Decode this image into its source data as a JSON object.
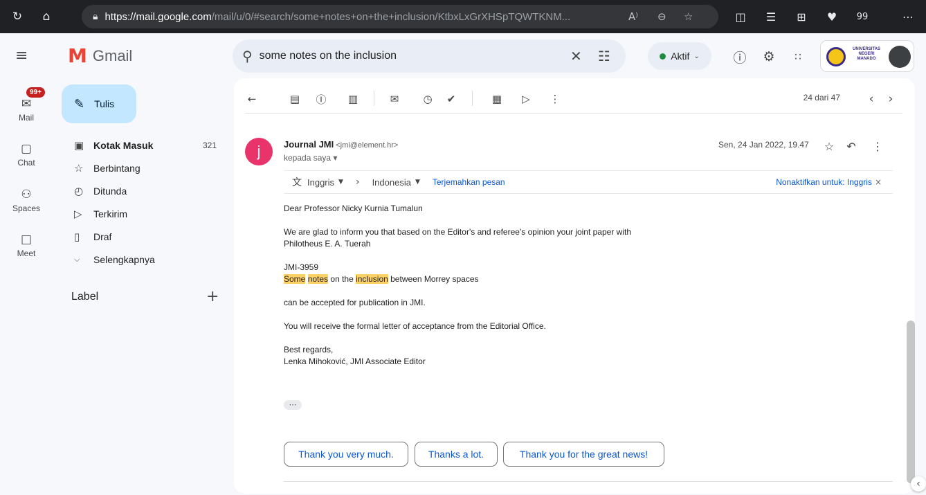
{
  "browser": {
    "url_host": "https://mail.google.com",
    "url_path": "/mail/u/0/#search/some+notes+on+the+inclusion/KtbxLxGrXHSpTQWTKNM...",
    "read_aloud": "A⁾",
    "toolbar_badge": "99"
  },
  "app": {
    "name": "Gmail",
    "status_label": "Aktif"
  },
  "rail": {
    "mail_label": "Mail",
    "mail_badge": "99+",
    "chat_label": "Chat",
    "spaces_label": "Spaces",
    "meet_label": "Meet"
  },
  "sidebar": {
    "compose_label": "Tulis",
    "items": [
      {
        "label": "Kotak Masuk",
        "count": "321"
      },
      {
        "label": "Berbintang",
        "count": ""
      },
      {
        "label": "Ditunda",
        "count": ""
      },
      {
        "label": "Terkirim",
        "count": ""
      },
      {
        "label": "Draf",
        "count": ""
      },
      {
        "label": "Selengkapnya",
        "count": ""
      }
    ],
    "label_heading": "Label"
  },
  "search": {
    "query": "some notes on the inclusion"
  },
  "org": {
    "name_lines": "UNIVERSITAS NEGERI MANADO"
  },
  "toolbar": {
    "pager": "24 dari 47"
  },
  "message": {
    "avatar_letter": "j",
    "sender_name": "Journal JMI",
    "sender_email": "<jmi@element.hr>",
    "recipient": "kepada saya ▾",
    "date": "Sen, 24 Jan 2022, 19.47",
    "translate": {
      "source_lang": "Inggris",
      "target_lang": "Indonesia",
      "translate_link": "Terjemahkan pesan",
      "disable_link": "Nonaktifkan untuk: Inggris"
    },
    "body": {
      "greeting": "Dear Professor Nicky Kurnia Tumalun",
      "line1": "We are glad to inform you that based on the Editor's and referee's opinion your joint paper with",
      "line2": "Philotheus E. A. Tuerah",
      "paper_id": "JMI-3959",
      "title_hl1": "Some",
      "title_hl2": "notes",
      "title_plain1": " on the ",
      "title_hl3": "inclusion",
      "title_plain2": " between Morrey spaces",
      "accepted": "can be accepted for publication in JMI.",
      "formal": "You will receive the formal letter of acceptance from the Editorial Office.",
      "regards": "Best regards,",
      "signature": "Lenka Mihoković, JMI Associate Editor"
    },
    "smart_replies": [
      "Thank you very much.",
      "Thanks a lot.",
      "Thank you for the great news!"
    ]
  }
}
